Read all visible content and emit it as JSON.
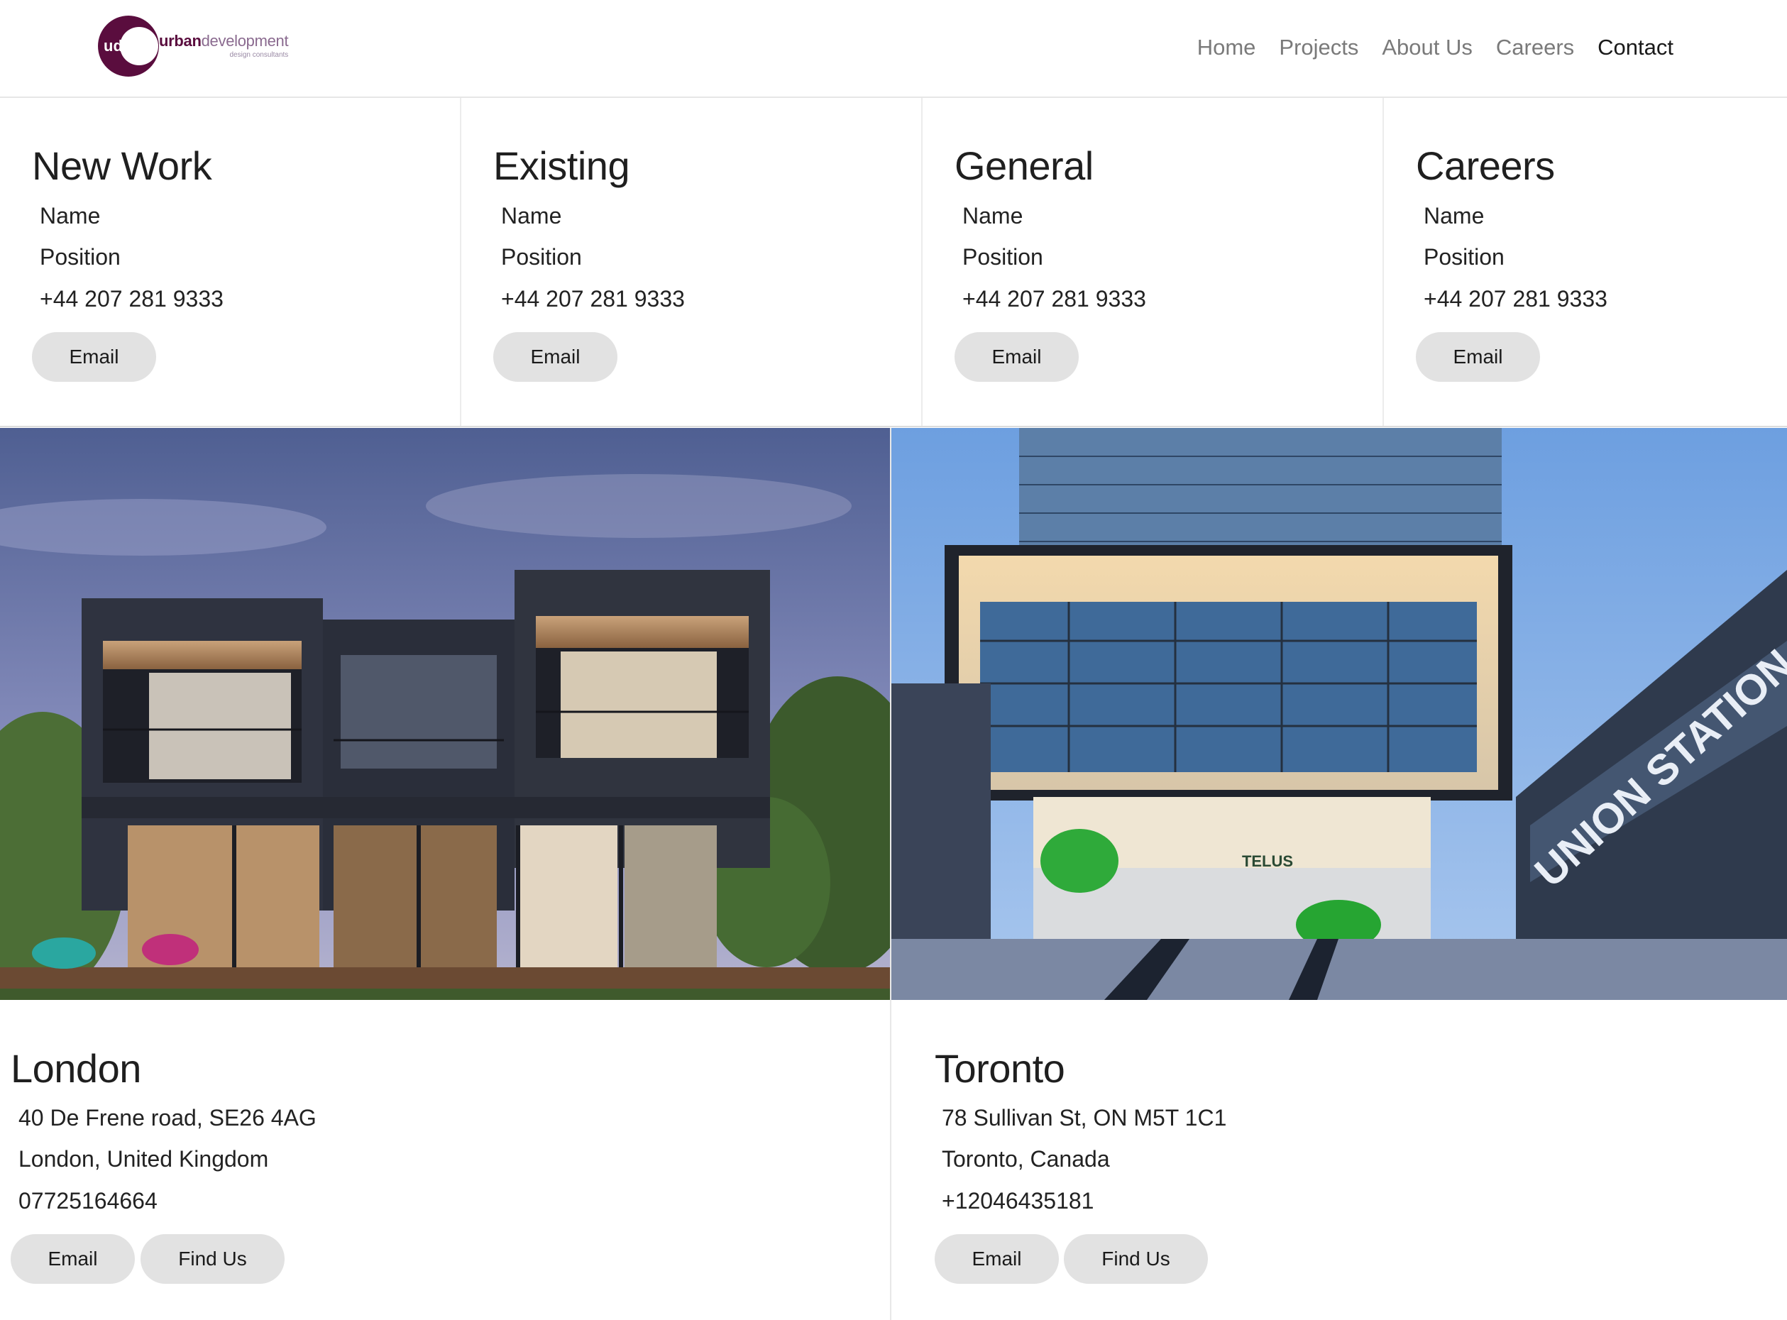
{
  "header": {
    "logo": {
      "mark": "ud",
      "word_strong": "urban",
      "word_light": "development",
      "tagline": "design consultants"
    },
    "nav": [
      {
        "label": "Home",
        "active": false
      },
      {
        "label": "Projects",
        "active": false
      },
      {
        "label": "About Us",
        "active": false
      },
      {
        "label": "Careers",
        "active": false
      },
      {
        "label": "Contact",
        "active": true
      }
    ]
  },
  "contacts": [
    {
      "title": "New Work",
      "name": "Name",
      "position": "Position",
      "phone": "+44 207 281 9333",
      "email_label": "Email"
    },
    {
      "title": "Existing",
      "name": "Name",
      "position": "Position",
      "phone": "+44 207 281 9333",
      "email_label": "Email"
    },
    {
      "title": "General",
      "name": "Name",
      "position": "Position",
      "phone": "+44 207 281 9333",
      "email_label": "Email"
    },
    {
      "title": "Careers",
      "name": "Name",
      "position": "Position",
      "phone": "+44 207 281 9333",
      "email_label": "Email"
    }
  ],
  "offices": {
    "london": {
      "city": "London",
      "address1": "40 De Frene road, SE26 4AG",
      "address2": "London, United Kingdom",
      "phone": "07725164664",
      "email_label": "Email",
      "find_label": "Find Us"
    },
    "toronto": {
      "city": "Toronto",
      "address1": "78 Sullivan St, ON M5T 1C1",
      "address2": "Toronto, Canada",
      "phone": "+12046435181",
      "email_label": "Email",
      "find_label": "Find Us",
      "photo_sign_main": "UNION STATION",
      "photo_sign_tenant": "TELUS"
    }
  },
  "colors": {
    "brand": "#5a0d3e",
    "nav_inactive": "#7a7a7a",
    "nav_active": "#1a1a1a",
    "pill_bg": "#e2e2e2"
  }
}
